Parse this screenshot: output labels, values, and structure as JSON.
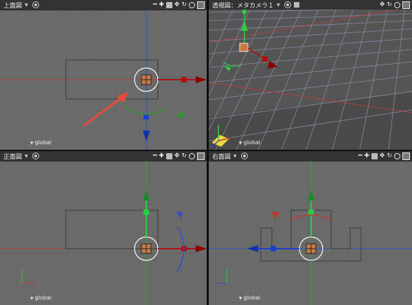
{
  "viewports": {
    "top": {
      "title": "上面図",
      "coord": "global"
    },
    "perspective": {
      "title": "透視図：メタカメラ１",
      "coord": "global"
    },
    "front": {
      "title": "正面図",
      "coord": "global"
    },
    "right": {
      "title": "右面図",
      "coord": "global"
    }
  },
  "toolbar_icons": [
    "zoom-out-icon",
    "zoom-in-icon",
    "camera-icon",
    "move-icon",
    "rotate-icon",
    "magnify-icon",
    "window-icon"
  ],
  "colors": {
    "viewport_bg": "#6b6b6b",
    "grid_line": "#5e5e5e",
    "x_axis": "#c0392b",
    "y_axis": "#2ecc40",
    "z_axis": "#1e4bd6",
    "annotation_arrow": "#e74c3c"
  }
}
